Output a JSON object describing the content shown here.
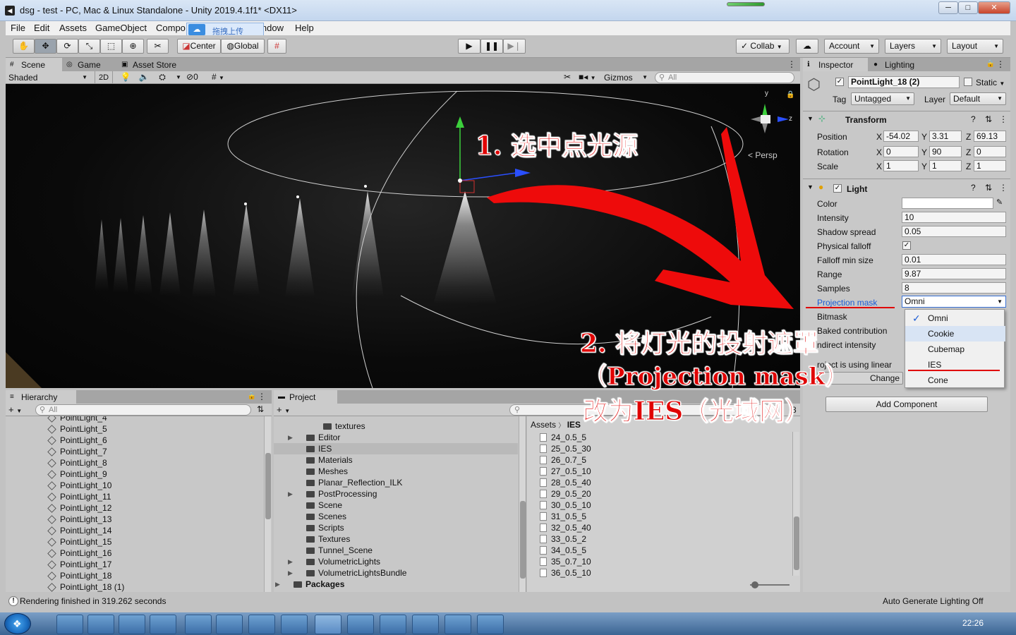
{
  "window": {
    "title": "dsg - test - PC, Mac & Linux Standalone - Unity 2019.4.1f1* <DX11>",
    "minimize": "─",
    "maximize": "□",
    "close": "✕"
  },
  "menubar": {
    "items": [
      "File",
      "Edit",
      "Assets",
      "GameObject",
      "Compo",
      "indow",
      "Help"
    ],
    "overlay_label": "拖拽上传"
  },
  "toolbar": {
    "center": "Center",
    "global": "Global",
    "collab": "Collab",
    "account": "Account",
    "layers": "Layers",
    "layout": "Layout"
  },
  "scene_panel": {
    "tabs": [
      "Scene",
      "Game",
      "Asset Store"
    ],
    "shading_mode": "Shaded",
    "mode_2d": "2D",
    "hidden_count": "0",
    "gizmos": "Gizmos",
    "search_placeholder": "All",
    "persp_label": "Persp",
    "axis_y": "y",
    "axis_z": "z"
  },
  "inspector": {
    "tabs": [
      "Inspector",
      "Lighting"
    ],
    "object_name": "PointLight_18 (2)",
    "static_label": "Static",
    "tag_label": "Tag",
    "tag_value": "Untagged",
    "layer_label": "Layer",
    "layer_value": "Default",
    "transform": {
      "title": "Transform",
      "position_label": "Position",
      "rotation_label": "Rotation",
      "scale_label": "Scale",
      "axis_x": "X",
      "axis_y": "Y",
      "axis_z": "Z",
      "position": [
        "-54.02",
        "3.31",
        "69.13"
      ],
      "rotation": [
        "0",
        "90",
        "0"
      ],
      "scale": [
        "1",
        "1",
        "1"
      ]
    },
    "light": {
      "title": "Light",
      "color_label": "Color",
      "intensity_label": "Intensity",
      "intensity": "10",
      "shadow_spread_label": "Shadow spread",
      "shadow_spread": "0.05",
      "physical_falloff_label": "Physical falloff",
      "physical_falloff": "✓",
      "falloff_min_label": "Falloff min size",
      "falloff_min": "0.01",
      "range_label": "Range",
      "range": "9.87",
      "samples_label": "Samples",
      "samples": "8",
      "projection_mask_label": "Projection mask",
      "projection_mask": "Omni",
      "bitmask_label": "Bitmask",
      "baked_label": "Baked contribution",
      "indirect_label": "ndirect intensity",
      "linear_label": "roject is using linear",
      "change_label": "Change"
    },
    "dropdown_options": [
      "Omni",
      "Cookie",
      "Cubemap",
      "IES",
      "Cone"
    ],
    "dropdown_check": "✓",
    "add_component": "Add Component"
  },
  "hierarchy": {
    "title": "Hierarchy",
    "search_placeholder": "All",
    "items": [
      "PointLight_4",
      "PointLight_5",
      "PointLight_6",
      "PointLight_7",
      "PointLight_8",
      "PointLight_9",
      "PointLight_10",
      "PointLight_11",
      "PointLight_12",
      "PointLight_13",
      "PointLight_14",
      "PointLight_15",
      "PointLight_16",
      "PointLight_17",
      "PointLight_18",
      "PointLight_18 (1)"
    ]
  },
  "project": {
    "title": "Project",
    "count": "8",
    "folders": [
      "textures",
      "Editor",
      "IES",
      "Materials",
      "Meshes",
      "Planar_Reflection_ILK",
      "PostProcessing",
      "Scene",
      "Scenes",
      "Scripts",
      "Textures",
      "Tunnel_Scene",
      "VolumetricLights",
      "VolumetricLightsBundle",
      "Packages"
    ],
    "breadcrumb": [
      "Assets",
      "IES"
    ],
    "files": [
      "24_0.5_5",
      "25_0.5_30",
      "26_0.7_5",
      "27_0.5_10",
      "28_0.5_40",
      "29_0.5_20",
      "30_0.5_10",
      "31_0.5_5",
      "32_0.5_40",
      "33_0.5_2",
      "34_0.5_5",
      "35_0.7_10",
      "36_0.5_10"
    ]
  },
  "statusbar": {
    "message": "Rendering finished in 319.262 seconds",
    "right": "Auto Generate Lighting Off"
  },
  "annotations": {
    "step1": "1. 选中点光源",
    "step2_line1": "2. 将灯光的投射遮罩",
    "step2_line2": "（Projection mask）",
    "step2_line3": "改为IES（光域网）"
  },
  "taskbar": {
    "clock": "22:26"
  },
  "colors": {
    "annotation_red": "#e00000",
    "link_blue": "#1a5bd6",
    "selection_blue": "#3a72d6"
  }
}
